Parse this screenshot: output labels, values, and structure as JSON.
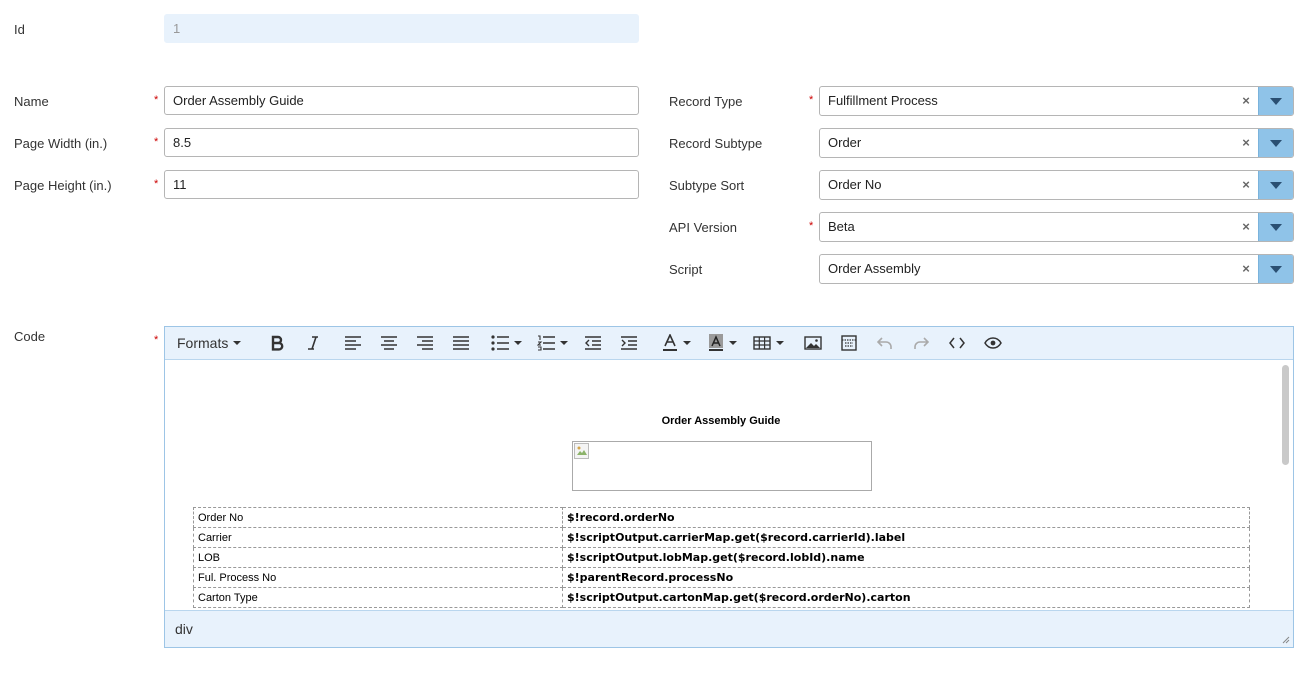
{
  "fields": {
    "id": {
      "label": "Id",
      "value": "1"
    },
    "name": {
      "label": "Name",
      "value": "Order Assembly Guide"
    },
    "page_width": {
      "label": "Page Width (in.)",
      "value": "8.5"
    },
    "page_height": {
      "label": "Page Height (in.)",
      "value": "11"
    },
    "record_type": {
      "label": "Record Type",
      "value": "Fulfillment Process"
    },
    "record_subtype": {
      "label": "Record Subtype",
      "value": "Order"
    },
    "subtype_sort": {
      "label": "Subtype Sort",
      "value": "Order No"
    },
    "api_version": {
      "label": "API Version",
      "value": "Beta"
    },
    "script": {
      "label": "Script",
      "value": "Order Assembly"
    },
    "code": {
      "label": "Code"
    }
  },
  "required_mark": "*",
  "clear_mark": "×",
  "editor": {
    "toolbar": {
      "formats_label": "Formats"
    },
    "document": {
      "title": "Order Assembly Guide",
      "rows": [
        {
          "label": "Order No",
          "value": "$!record.orderNo"
        },
        {
          "label": "Carrier",
          "value": "$!scriptOutput.carrierMap.get($record.carrierId).label"
        },
        {
          "label": "LOB",
          "value": "$!scriptOutput.lobMap.get($record.lobId).name"
        },
        {
          "label": "Ful. Process No",
          "value": "$!parentRecord.processNo"
        },
        {
          "label": "Carton Type",
          "value": "$!scriptOutput.cartonMap.get($record.orderNo).carton"
        }
      ]
    },
    "status_path": "div"
  },
  "colors": {
    "accent": "#8fc3e8",
    "toolbar_bg": "#e8f2fc",
    "required": "#cc0000"
  }
}
